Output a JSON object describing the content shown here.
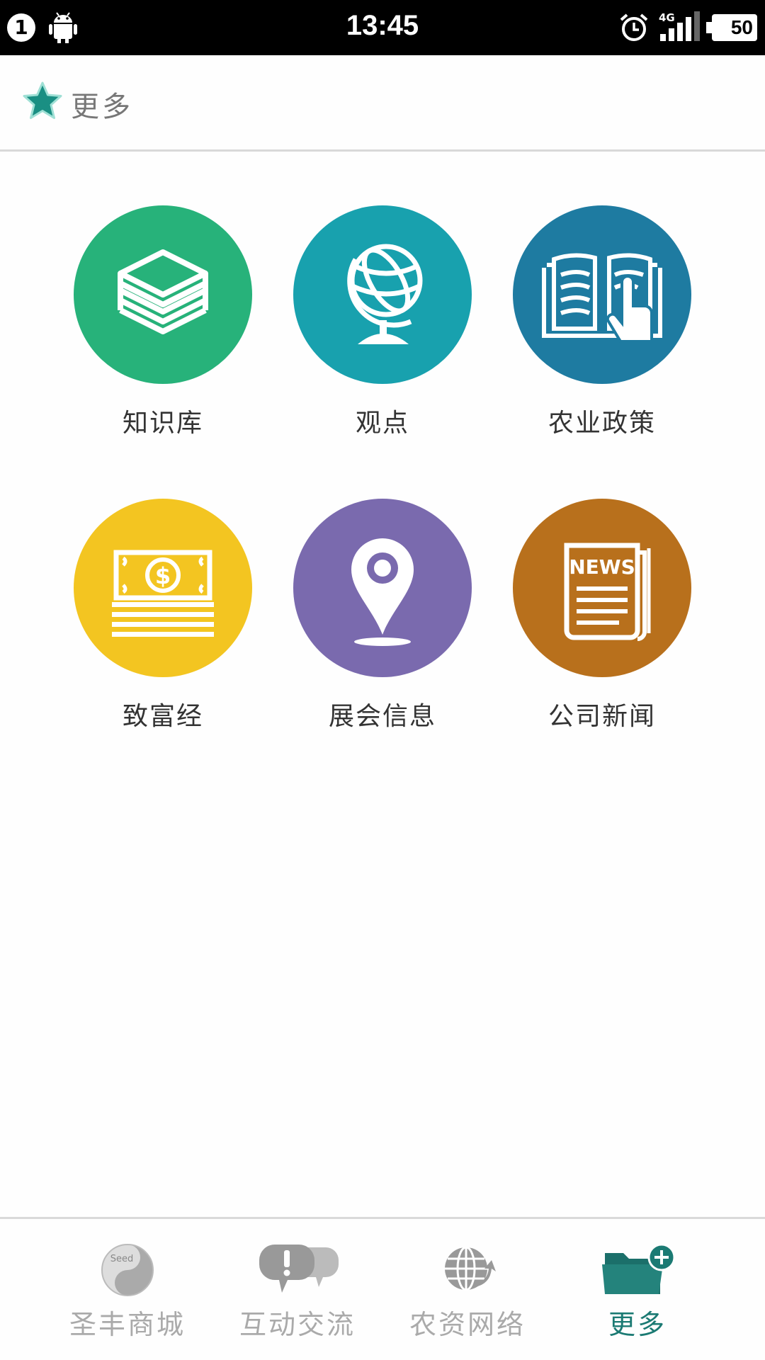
{
  "status_bar": {
    "notification_count": "1",
    "time": "13:45",
    "network": "4G",
    "battery": "50"
  },
  "header": {
    "title": "更多",
    "icon": "star-icon",
    "icon_color": "#1a8f83"
  },
  "tiles": [
    {
      "label": "知识库",
      "icon": "book-stack-icon",
      "color": "#27b27a"
    },
    {
      "label": "观点",
      "icon": "globe-icon",
      "color": "#18a1ae"
    },
    {
      "label": "农业政策",
      "icon": "open-book-touch-icon",
      "color": "#1e7ba1"
    },
    {
      "label": "致富经",
      "icon": "money-stack-icon",
      "color": "#f3c521"
    },
    {
      "label": "展会信息",
      "icon": "location-pin-icon",
      "color": "#7a6aae"
    },
    {
      "label": "公司新闻",
      "icon": "newspaper-icon",
      "color": "#b8701c"
    }
  ],
  "news_text": "NEWS",
  "seed_text": "Seed",
  "bottom_nav": [
    {
      "label": "圣丰商城",
      "icon": "seed-logo-icon",
      "active": false
    },
    {
      "label": "互动交流",
      "icon": "chat-bubbles-icon",
      "active": false
    },
    {
      "label": "农资网络",
      "icon": "globe-network-icon",
      "active": false
    },
    {
      "label": "更多",
      "icon": "folder-add-icon",
      "active": true
    }
  ],
  "colors": {
    "active": "#1b7a73",
    "inactive": "#aaaaaa"
  }
}
